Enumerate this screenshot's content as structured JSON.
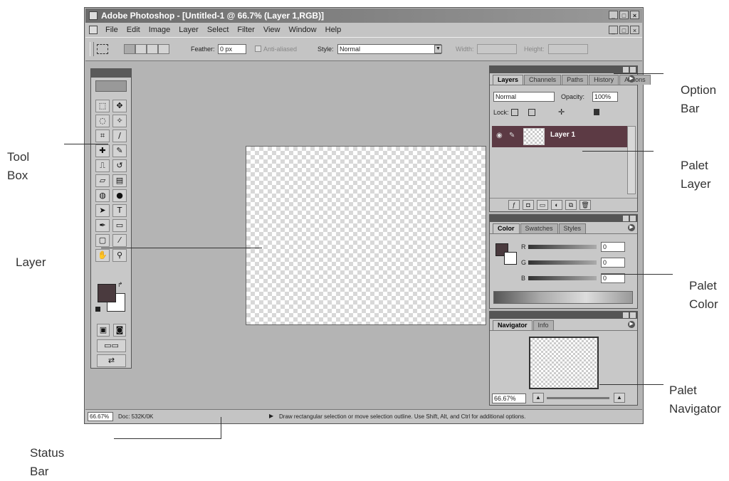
{
  "window": {
    "title": "Adobe Photoshop - [Untitled-1 @ 66.7% (Layer 1,RGB)]",
    "controls": [
      "_",
      "□",
      "×"
    ]
  },
  "menu": {
    "items": [
      "File",
      "Edit",
      "Image",
      "Layer",
      "Select",
      "Filter",
      "View",
      "Window",
      "Help"
    ]
  },
  "options_bar": {
    "feather_label": "Feather:",
    "feather_value": "0 px",
    "antialiased_label": "Anti-aliased",
    "style_label": "Style:",
    "style_value": "Normal",
    "width_label": "Width:",
    "height_label": "Height:"
  },
  "toolbox": {
    "tools": [
      [
        "marquee-icon",
        "move-icon"
      ],
      [
        "lasso-icon",
        "magic-wand-icon"
      ],
      [
        "crop-icon",
        "slice-icon"
      ],
      [
        "healing-brush-icon",
        "brush-icon"
      ],
      [
        "clone-stamp-icon",
        "history-brush-icon"
      ],
      [
        "eraser-icon",
        "gradient-icon"
      ],
      [
        "blur-icon",
        "dodge-icon"
      ],
      [
        "path-selection-icon",
        "type-icon"
      ],
      [
        "pen-icon",
        "rectangle-icon"
      ],
      [
        "notes-icon",
        "eyedropper-icon"
      ],
      [
        "hand-icon",
        "zoom-icon"
      ]
    ],
    "type_glyph": "T"
  },
  "layers_palette": {
    "tabs": [
      "Layers",
      "Channels",
      "Paths",
      "History",
      "Actions"
    ],
    "blend_mode": "Normal",
    "opacity_label": "Opacity:",
    "opacity_value": "100%",
    "lock_label": "Lock:",
    "layer_name": "Layer 1"
  },
  "color_palette": {
    "tabs": [
      "Color",
      "Swatches",
      "Styles"
    ],
    "channels": [
      {
        "label": "R",
        "value": "0"
      },
      {
        "label": "G",
        "value": "0"
      },
      {
        "label": "B",
        "value": "0"
      }
    ]
  },
  "navigator_palette": {
    "tabs": [
      "Navigator",
      "Info"
    ],
    "zoom_value": "66.67%"
  },
  "status_bar": {
    "zoom": "66.67%",
    "doc": "Doc: 532K/0K",
    "hint": "Draw rectangular selection or move selection outline. Use Shift, Alt, and Ctrl for additional options."
  },
  "annotations": {
    "option_bar": [
      "Option",
      "Bar"
    ],
    "tool_box": [
      "Tool",
      "Box"
    ],
    "layer": [
      "Layer"
    ],
    "palet_layer": [
      "Palet",
      "Layer"
    ],
    "palet_color": [
      "Palet",
      "Color"
    ],
    "palet_navigator": [
      "Palet",
      "Navigator"
    ],
    "status_bar": [
      "Status",
      "Bar"
    ]
  },
  "colors": {
    "title_bar": "#6b6b6b",
    "active_layer": "#5c3a44",
    "foreground_swatch": "#4a3a3e"
  }
}
